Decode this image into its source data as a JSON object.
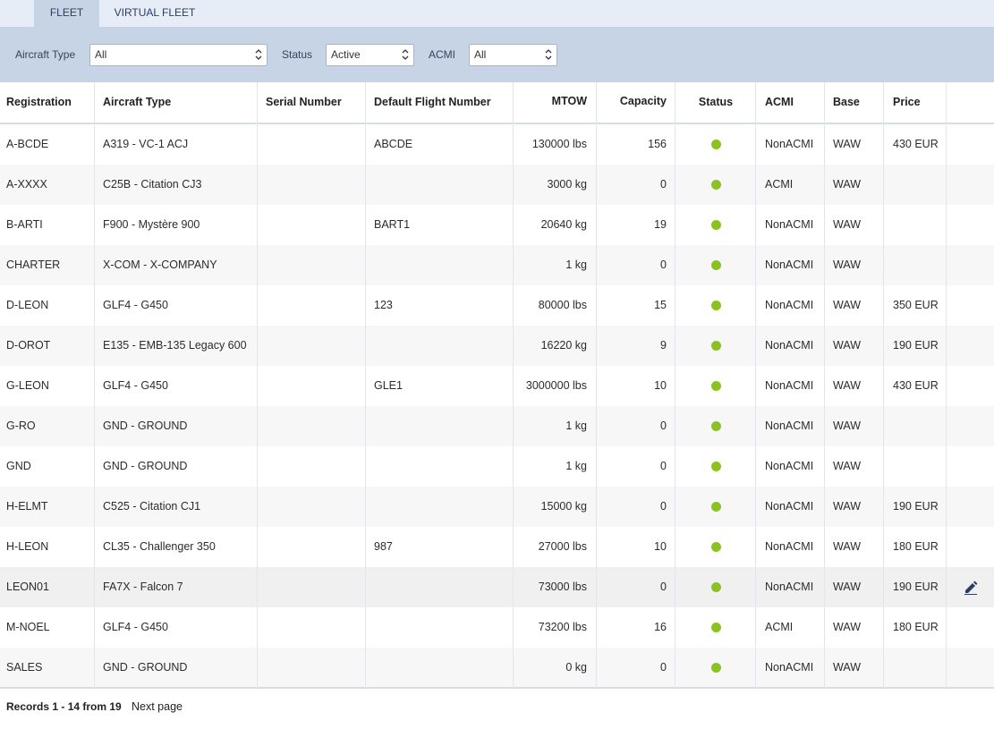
{
  "tabs": [
    {
      "label": "FLEET",
      "active": true
    },
    {
      "label": "VIRTUAL FLEET",
      "active": false
    }
  ],
  "filters": {
    "aircraft_type": {
      "label": "Aircraft Type",
      "value": "All"
    },
    "status": {
      "label": "Status",
      "value": "Active"
    },
    "acmi": {
      "label": "ACMI",
      "value": "All"
    }
  },
  "table": {
    "columns": [
      "Registration",
      "Aircraft Type",
      "Serial Number",
      "Default Flight Number",
      "MTOW",
      "Capacity",
      "Status",
      "ACMI",
      "Base",
      "Price"
    ],
    "rows": [
      {
        "registration": "A-BCDE",
        "aircraft_type": "A319 - VC-1 ACJ",
        "serial_number": "",
        "default_flight_number": "ABCDE",
        "mtow": "130000 lbs",
        "capacity": "156",
        "status": "active",
        "acmi": "NonACMI",
        "base": "WAW",
        "price": "430 EUR"
      },
      {
        "registration": "A-XXXX",
        "aircraft_type": "C25B - Citation CJ3",
        "serial_number": "",
        "default_flight_number": "",
        "mtow": "3000 kg",
        "capacity": "0",
        "status": "active",
        "acmi": "ACMI",
        "base": "WAW",
        "price": ""
      },
      {
        "registration": "B-ARTI",
        "aircraft_type": "F900 - Mystère 900",
        "serial_number": "",
        "default_flight_number": "BART1",
        "mtow": "20640 kg",
        "capacity": "19",
        "status": "active",
        "acmi": "NonACMI",
        "base": "WAW",
        "price": ""
      },
      {
        "registration": "CHARTER",
        "aircraft_type": "X-COM - X-COMPANY",
        "serial_number": "",
        "default_flight_number": "",
        "mtow": "1 kg",
        "capacity": "0",
        "status": "active",
        "acmi": "NonACMI",
        "base": "WAW",
        "price": ""
      },
      {
        "registration": "D-LEON",
        "aircraft_type": "GLF4 - G450",
        "serial_number": "",
        "default_flight_number": "123",
        "mtow": "80000 lbs",
        "capacity": "15",
        "status": "active",
        "acmi": "NonACMI",
        "base": "WAW",
        "price": "350 EUR"
      },
      {
        "registration": "D-OROT",
        "aircraft_type": "E135 - EMB-135 Legacy 600",
        "serial_number": "",
        "default_flight_number": "",
        "mtow": "16220 kg",
        "capacity": "9",
        "status": "active",
        "acmi": "NonACMI",
        "base": "WAW",
        "price": "190 EUR"
      },
      {
        "registration": "G-LEON",
        "aircraft_type": "GLF4 - G450",
        "serial_number": "",
        "default_flight_number": "GLE1",
        "mtow": "3000000 lbs",
        "capacity": "10",
        "status": "active",
        "acmi": "NonACMI",
        "base": "WAW",
        "price": "430 EUR"
      },
      {
        "registration": "G-RO",
        "aircraft_type": "GND - GROUND",
        "serial_number": "",
        "default_flight_number": "",
        "mtow": "1 kg",
        "capacity": "0",
        "status": "active",
        "acmi": "NonACMI",
        "base": "WAW",
        "price": ""
      },
      {
        "registration": "GND",
        "aircraft_type": "GND - GROUND",
        "serial_number": "",
        "default_flight_number": "",
        "mtow": "1 kg",
        "capacity": "0",
        "status": "active",
        "acmi": "NonACMI",
        "base": "WAW",
        "price": ""
      },
      {
        "registration": "H-ELMT",
        "aircraft_type": "C525 - Citation CJ1",
        "serial_number": "",
        "default_flight_number": "",
        "mtow": "15000 kg",
        "capacity": "0",
        "status": "active",
        "acmi": "NonACMI",
        "base": "WAW",
        "price": "190 EUR"
      },
      {
        "registration": "H-LEON",
        "aircraft_type": "CL35 - Challenger 350",
        "serial_number": "",
        "default_flight_number": "987",
        "mtow": "27000 lbs",
        "capacity": "10",
        "status": "active",
        "acmi": "NonACMI",
        "base": "WAW",
        "price": "180 EUR"
      },
      {
        "registration": "LEON01",
        "aircraft_type": "FA7X - Falcon 7",
        "serial_number": "",
        "default_flight_number": "",
        "mtow": "73000 lbs",
        "capacity": "0",
        "status": "active",
        "acmi": "NonACMI",
        "base": "WAW",
        "price": "190 EUR",
        "hovered": true
      },
      {
        "registration": "M-NOEL",
        "aircraft_type": "GLF4 - G450",
        "serial_number": "",
        "default_flight_number": "",
        "mtow": "73200 lbs",
        "capacity": "16",
        "status": "active",
        "acmi": "ACMI",
        "base": "WAW",
        "price": "180 EUR"
      },
      {
        "registration": "SALES",
        "aircraft_type": "GND - GROUND",
        "serial_number": "",
        "default_flight_number": "",
        "mtow": "0 kg",
        "capacity": "0",
        "status": "active",
        "acmi": "NonACMI",
        "base": "WAW",
        "price": ""
      }
    ]
  },
  "footer": {
    "records": "Records 1 - 14 from 19",
    "next_page": "Next page"
  },
  "colors": {
    "tab_active_bg": "#c6d4e6",
    "filter_bar_bg": "#c6d4e6",
    "status_active": "#8cc220",
    "edit_icon": "#2c3e63"
  },
  "icons": {
    "select": "chevron-up-down-icon",
    "edit": "pencil-icon",
    "status": "status-dot-icon"
  }
}
